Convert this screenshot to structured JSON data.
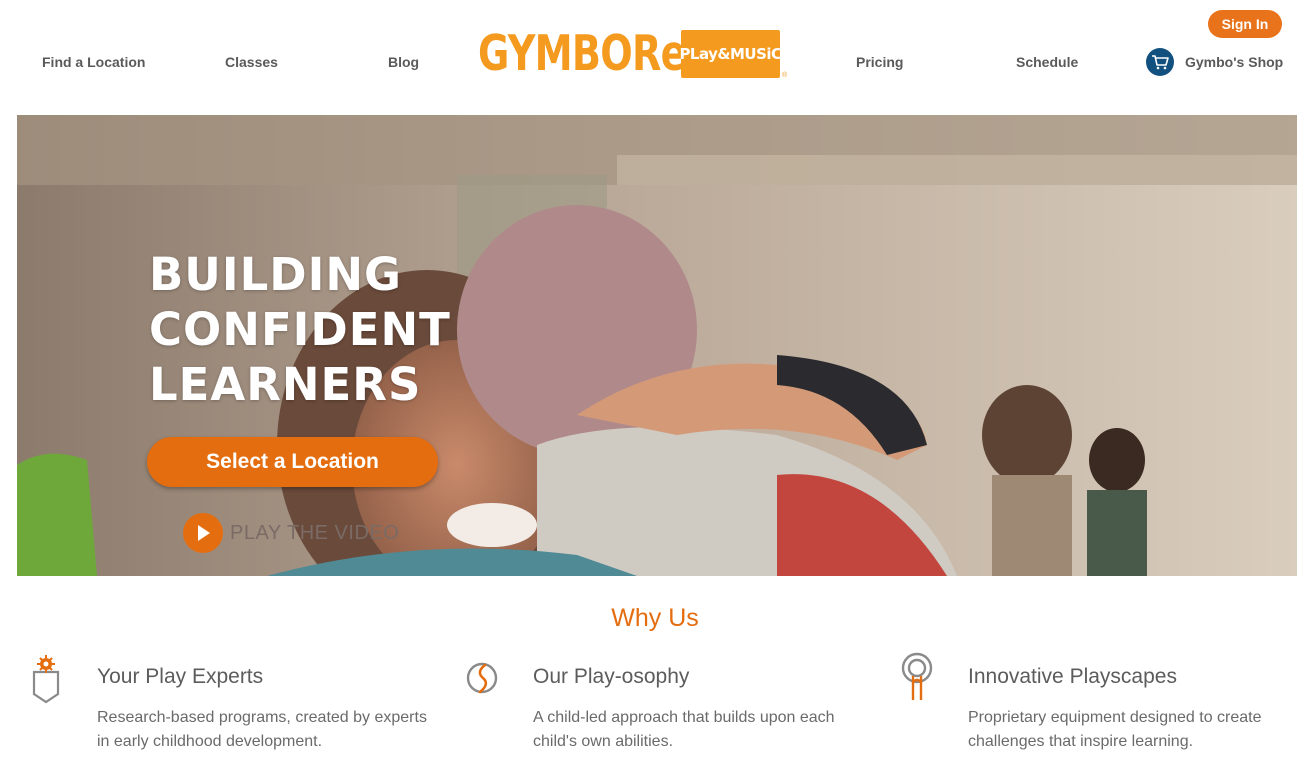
{
  "header": {
    "nav_left": [
      "Find a Location",
      "Classes",
      "Blog"
    ],
    "nav_right": [
      "Pricing",
      "Schedule"
    ],
    "signin_label": "Sign In",
    "shop_label": "Gymbo's Shop",
    "logo": {
      "word": "GYMBOReE",
      "badge": "PLay&MUSiC",
      "reg": "®"
    }
  },
  "hero": {
    "headline": [
      "BUILDING",
      "CONFIDENT",
      "LEARNERS"
    ],
    "cta_label": "Select a Location",
    "video_label": "PLAY THE VIDEO"
  },
  "why_us": {
    "title": "Why Us",
    "features": [
      {
        "icon": "badge-gear-icon",
        "title": "Your Play Experts",
        "desc": "Research-based programs, created by experts in early childhood development."
      },
      {
        "icon": "circle-swirl-icon",
        "title": "Our Play-osophy",
        "desc": "A child-led approach that builds upon each child's own abilities."
      },
      {
        "icon": "target-ring-icon",
        "title": "Innovative Playscapes",
        "desc": "Proprietary equipment designed to create challenges that inspire learning."
      }
    ]
  },
  "colors": {
    "accent": "#e46d10",
    "logo": "#f39a1f",
    "cart": "#11507f"
  }
}
